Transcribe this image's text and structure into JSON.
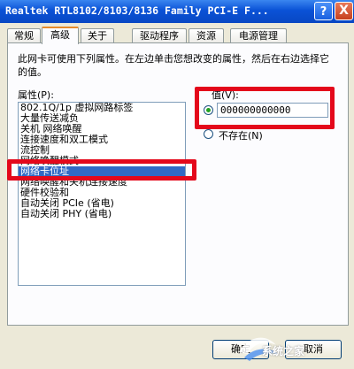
{
  "window": {
    "title": "Realtek RTL8102/8103/8136 Family PCI-E F..."
  },
  "titlebar_buttons": {
    "help": "?",
    "close": "X"
  },
  "tabs": [
    {
      "label": "常规"
    },
    {
      "label": "高级"
    },
    {
      "label": "关于"
    },
    {
      "label": "驱动程序"
    },
    {
      "label": "资源"
    },
    {
      "label": "电源管理"
    }
  ],
  "active_tab": "高级",
  "panel": {
    "description": "此网卡可使用下列属性。在左边单击您想改变的属性，然后在右边选择它的值。",
    "properties_label": "属性(P):",
    "value_label": "值(V):",
    "value_input": "000000000000",
    "not_present_label": "不存在(N)",
    "properties": [
      "802.1Q/1p 虚拟网路标签",
      "大量传送减负",
      "关机 网络唤醒",
      "连接速度和双工模式",
      "流控制",
      "网络唤醒模式",
      "网络卡位址",
      "网络唤醒和关机连接速度",
      "硬件校验和",
      "自动关闭 PCIe (省电)",
      "自动关闭 PHY (省电)"
    ],
    "selected_property": "网络卡位址"
  },
  "buttons": {
    "ok": "确定",
    "cancel": "取消"
  },
  "watermark": {
    "text": "系统之家"
  },
  "colors": {
    "highlight_box": "#e4081b",
    "selection": "#316ac5",
    "titlebar": "#0a52d6"
  }
}
